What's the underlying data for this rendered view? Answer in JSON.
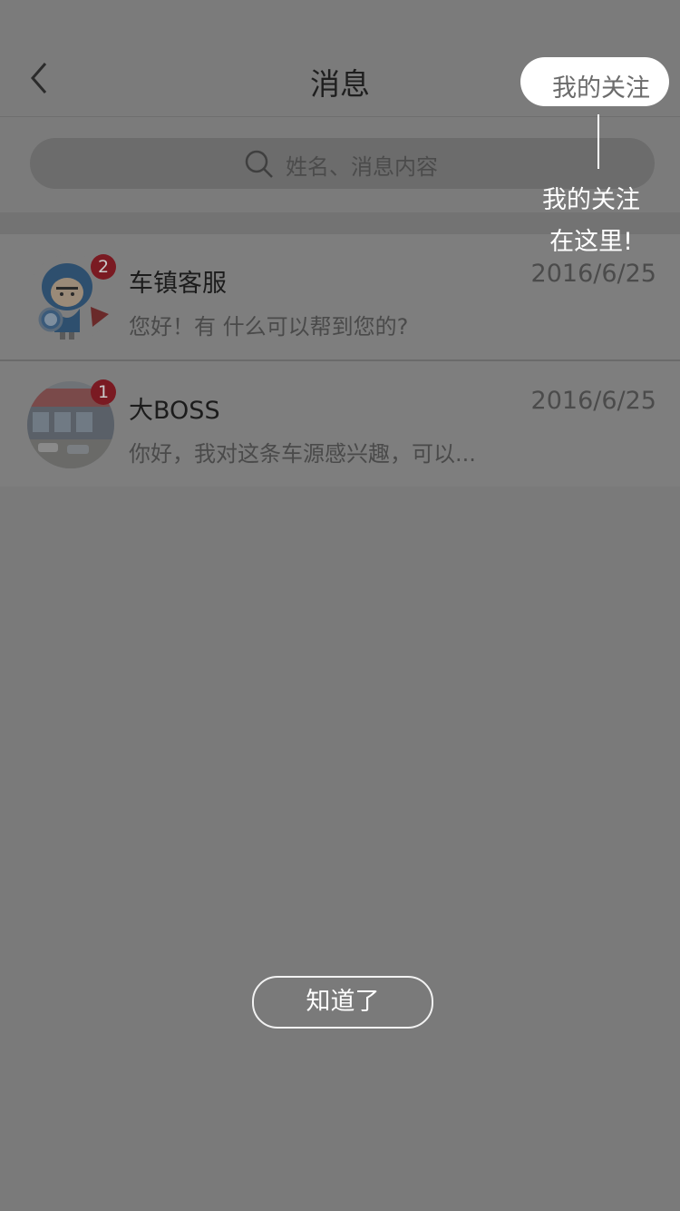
{
  "nav": {
    "title": "消息"
  },
  "search": {
    "placeholder": "姓名、消息内容"
  },
  "conversations": [
    {
      "name": "车镇客服",
      "time": "2016/6/25",
      "preview": "您好！有 什么可以帮到您的?",
      "unread": "2"
    },
    {
      "name": "大BOSS",
      "time": "2016/6/25",
      "preview": "你好，我对这条车源感兴趣，可以...",
      "unread": "1"
    }
  ],
  "guide": {
    "follow_label": "我的关注",
    "tip_line1": "我的关注",
    "tip_line2": "在这里!",
    "ok_label": "知道了"
  },
  "colors": {
    "overlay": "#7a7a7a",
    "badge": "#7a1a22",
    "highlight": "#ffffff"
  }
}
